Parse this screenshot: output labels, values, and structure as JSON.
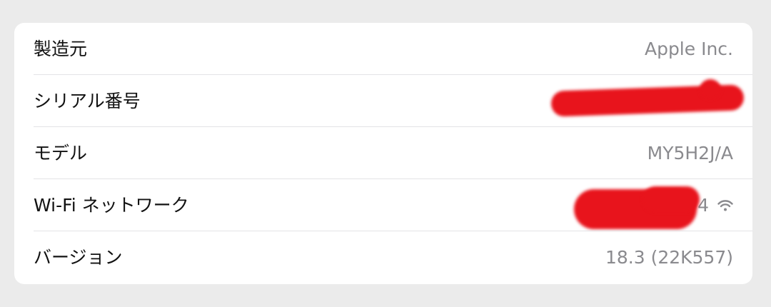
{
  "rows": [
    {
      "label": "製造元",
      "value": "Apple Inc."
    },
    {
      "label": "シリアル番号",
      "value": ""
    },
    {
      "label": "モデル",
      "value": "MY5H2J/A"
    },
    {
      "label": "Wi-Fi ネットワーク",
      "value": "4"
    },
    {
      "label": "バージョン",
      "value": "18.3 (22K557)"
    }
  ],
  "colors": {
    "background": "#ebebeb",
    "card": "#ffffff",
    "label": "#111111",
    "value": "#8a8a8e",
    "redaction": "#e8141c"
  },
  "icons": {
    "wifi": "wifi-icon"
  }
}
